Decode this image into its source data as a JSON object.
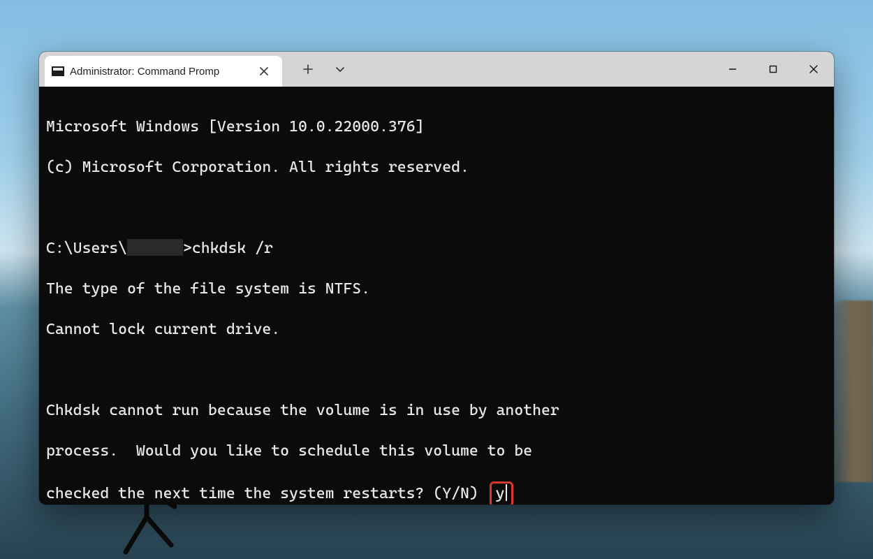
{
  "tab": {
    "title": "Administrator: Command Promp"
  },
  "terminal": {
    "line_version": "Microsoft Windows [Version 10.0.22000.376]",
    "line_copyright": "(c) Microsoft Corporation. All rights reserved.",
    "prompt_prefix": "C:\\Users\\",
    "prompt_suffix": ">",
    "command": "chkdsk /r",
    "line_fs": "The type of the file system is NTFS.",
    "line_lock": "Cannot lock current drive.",
    "line_inuse1": "Chkdsk cannot run because the volume is in use by another",
    "line_inuse2": "process.  Would you like to schedule this volume to be",
    "line_inuse3": "checked the next time the system restarts? (Y/N)",
    "input": "y"
  },
  "icons": {
    "close_x": "✕",
    "plus": "＋",
    "chevron": "⌄",
    "min": "—",
    "max": "□"
  }
}
